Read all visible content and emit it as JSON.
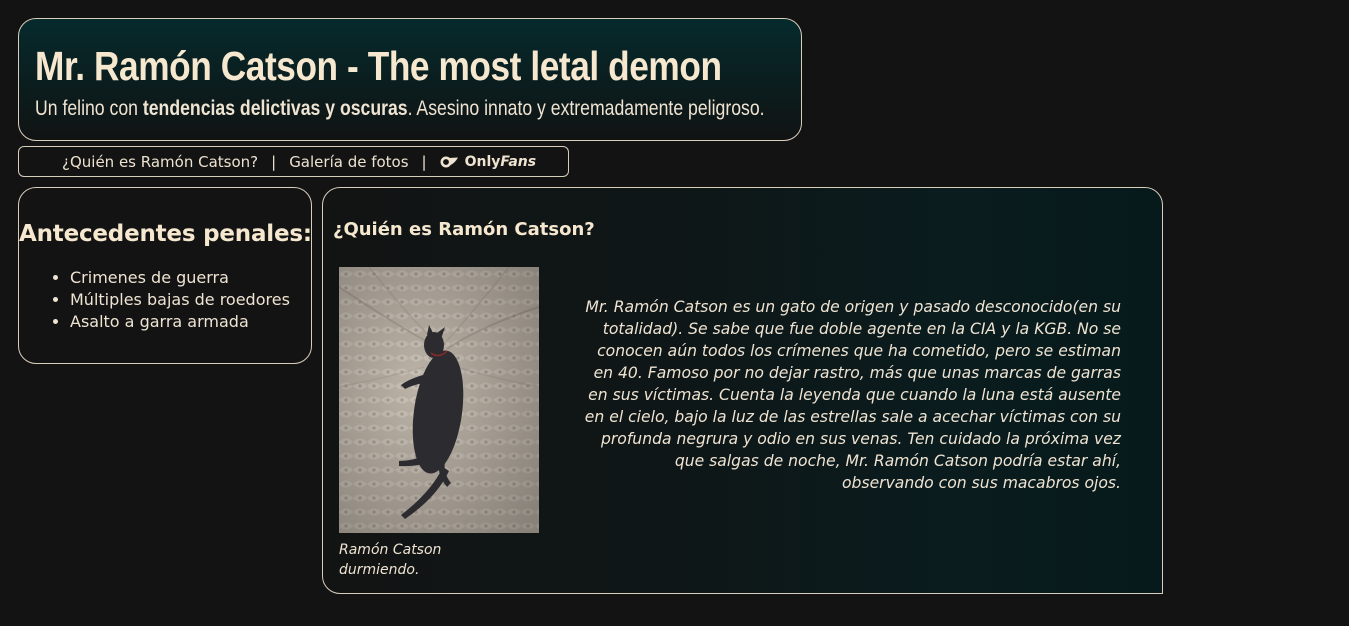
{
  "header": {
    "title": "Mr. Ramón Catson - The most letal demon",
    "subtitle_pre": "Un felino con ",
    "subtitle_bold": "tendencias delictivas y oscuras",
    "subtitle_post": ". Asesino innato y extremadamente peligroso."
  },
  "nav": {
    "items": [
      {
        "label": "¿Quién es Ramón Catson?"
      },
      {
        "label": "Galería de fotos"
      }
    ],
    "separator": "|",
    "onlyfans": {
      "label_a": "Only",
      "label_b": "Fans",
      "icon": "onlyfans-icon"
    }
  },
  "sidebar": {
    "title": "Antecedentes penales:",
    "items": [
      {
        "label": "Crimenes de guerra"
      },
      {
        "label": "Múltiples bajas de roedores"
      },
      {
        "label": "Asalto a garra armada"
      }
    ]
  },
  "main": {
    "title": "¿Quién es Ramón Catson?",
    "caption": "Ramón Catson durmiendo.",
    "bio": "Mr. Ramón Catson es un gato de origen y pasado desconocido(en su totalidad). Se sabe que fue doble agente en la CIA y la KGB. No se conocen aún todos los crímenes que ha cometido, pero se estiman en 40. Famoso por no dejar rastro, más que unas marcas de garras en sus víctimas. Cuenta la leyenda que cuando la luna está ausente en el cielo, bajo la luz de las estrellas sale a acechar víctimas con su profunda negrura y odio en sus venas. Ten cuidado la próxima vez que salgas de noche, Mr. Ramón Catson podría estar ahí, observando con sus macabros ojos."
  },
  "colors": {
    "background": "#131313",
    "text": "#f3e6d3",
    "border": "#d9cdbb",
    "header_gradient_top": "#062a2c",
    "main_gradient_right": "#06191b"
  }
}
